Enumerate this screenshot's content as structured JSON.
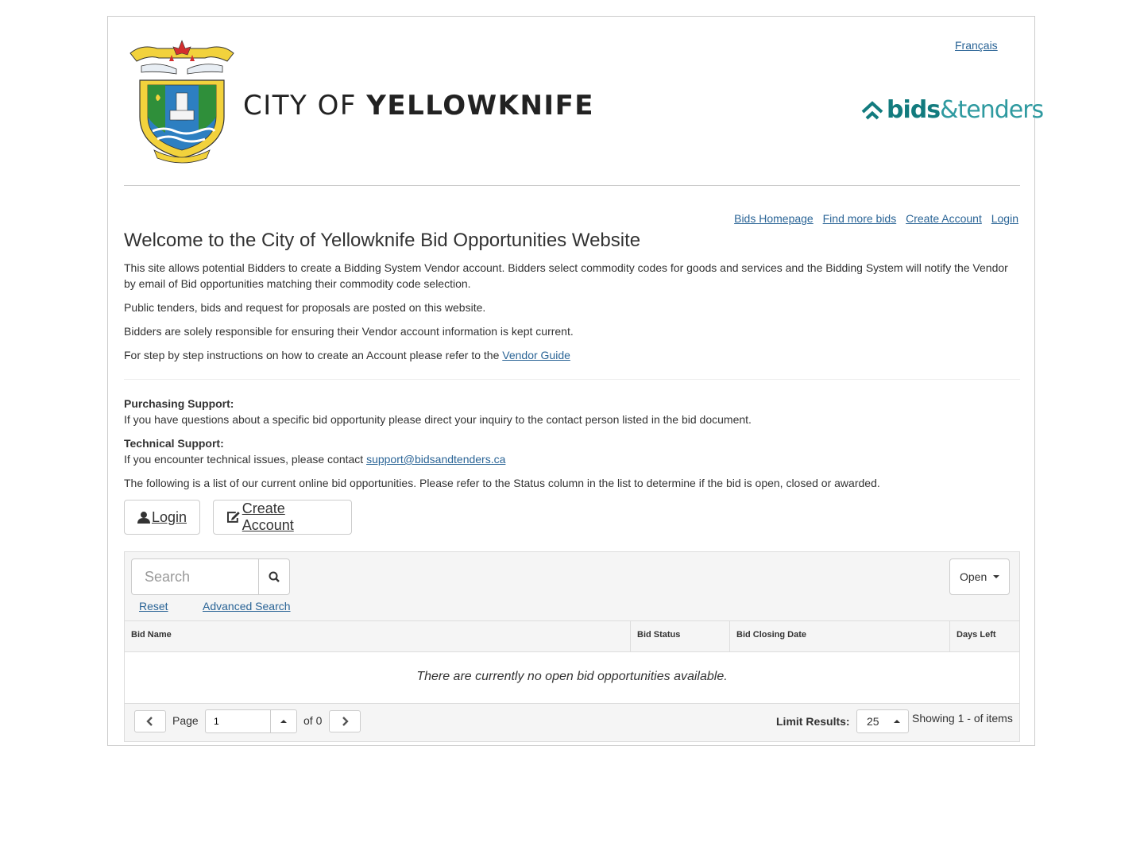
{
  "header": {
    "city_name_light": "CITY OF",
    "city_name_bold": "YELLOWKNIFE",
    "language_link": "Français",
    "brand_bids": "bids",
    "brand_tenders": "&tenders",
    "brand_color": "#127b7e"
  },
  "nav": {
    "items": [
      "Bids Homepage",
      "Find more bids",
      "Create Account",
      "Login"
    ]
  },
  "intro": {
    "title": "Welcome to the City of Yellowknife Bid Opportunities Website",
    "p1": "This site allows potential Bidders to create a Bidding System Vendor account.  Bidders select commodity codes for goods and services and the Bidding System will notify the Vendor by email of Bid opportunities matching their commodity code selection.",
    "p2": "Public tenders, bids and request for proposals are posted on this website.",
    "p3": "Bidders are solely responsible for ensuring their Vendor account information is kept current.",
    "p4_prefix": "For step by step instructions on how to create an Account please refer to the",
    "p4_link": "Vendor Guide"
  },
  "support": {
    "purchasing_title": "Purchasing Support:",
    "purchasing_text": "If you have questions about a specific bid opportunity please direct your inquiry to the contact person listed in the bid document.",
    "technical_title": "Technical Support:",
    "technical_prefix": "If you encounter technical issues, please contact",
    "technical_email": "support@bidsandtenders.ca",
    "list_intro": "The following is a list of our current online bid opportunities. Please refer to the Status column in the list to determine if the bid is open, closed or awarded."
  },
  "actions": {
    "login_label": "Login",
    "create_account_label": "Create Account"
  },
  "grid": {
    "search_placeholder": "Search",
    "reset_label": "Reset",
    "advanced_search_label": "Advanced Search",
    "status_filter": "Open",
    "columns": [
      "Bid Name",
      "Bid Status",
      "Bid Closing Date",
      "Days Left"
    ],
    "empty_message": "There are currently no open bid opportunities available.",
    "pager": {
      "page_label": "Page",
      "page_value": "1",
      "of_label": "of 0",
      "limit_label": "Limit Results:",
      "limit_value": "25",
      "showing_text": "Showing 1 - of items"
    }
  }
}
